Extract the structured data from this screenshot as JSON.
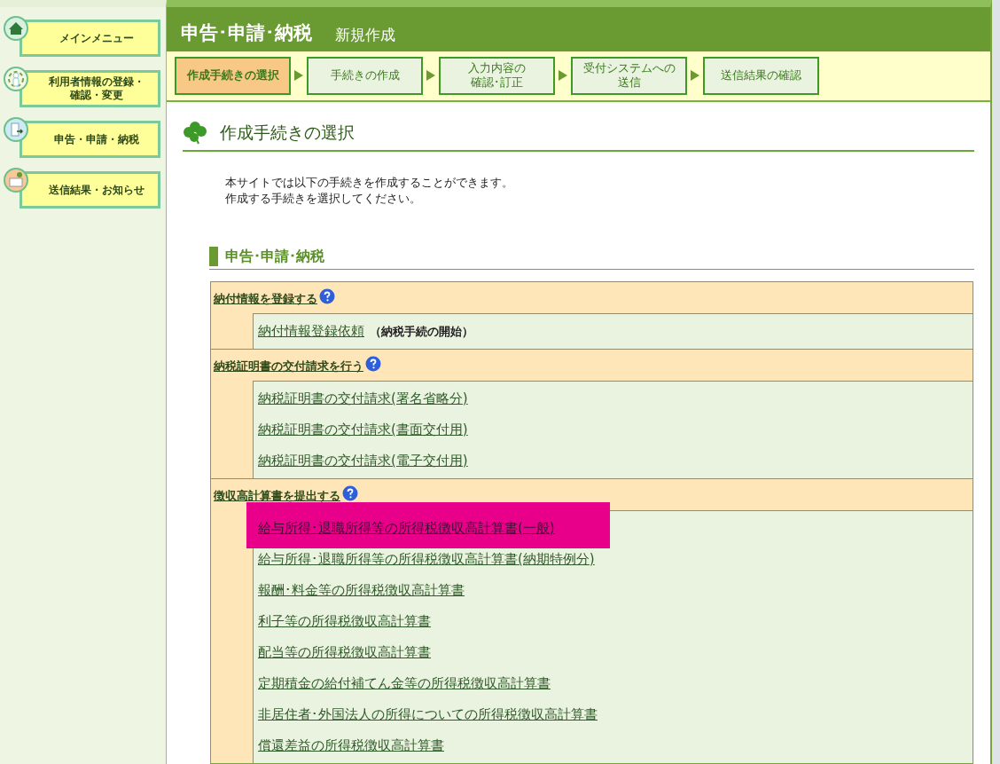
{
  "sidebar": {
    "items": [
      {
        "label": "メインメニュー",
        "kind": "house"
      },
      {
        "label": [
          "利用者情報の登録・",
          "確認・変更"
        ],
        "kind": "person"
      },
      {
        "label": "申告・申請・納税",
        "kind": "door"
      },
      {
        "label": "送信結果・お知らせ",
        "kind": "mail"
      }
    ]
  },
  "header": {
    "title": "申告･申請･納税",
    "subtitle": "新規作成"
  },
  "steps": [
    {
      "label": "作成手続きの選択",
      "selected": true
    },
    {
      "label": "手続きの作成",
      "selected": false
    },
    {
      "label": [
        "入力内容の",
        "確認･訂正"
      ],
      "selected": false
    },
    {
      "label": [
        "受付システムへの",
        "送信"
      ],
      "selected": false
    },
    {
      "label": "送信結果の確認",
      "selected": false
    }
  ],
  "page_title": "作成手続きの選択",
  "intro": [
    "本サイトでは以下の手続きを作成することができます。",
    "作成する手続きを選択してください。"
  ],
  "section_title": "申告･申請･納税",
  "groups": [
    {
      "title": "納付情報を登録する",
      "items": [
        {
          "label": "納付情報登録依頼",
          "note": "（納税手続の開始）",
          "highlighted": false
        }
      ]
    },
    {
      "title": "納税証明書の交付請求を行う",
      "items": [
        {
          "label": "納税証明書の交付請求(署名省略分)",
          "highlighted": false
        },
        {
          "label": "納税証明書の交付請求(書面交付用)",
          "highlighted": false
        },
        {
          "label": "納税証明書の交付請求(電子交付用)",
          "highlighted": false
        }
      ]
    },
    {
      "title": "徴収高計算書を提出する",
      "items": [
        {
          "label": "給与所得･退職所得等の所得税徴収高計算書(一般)",
          "highlighted": true
        },
        {
          "label": "給与所得･退職所得等の所得税徴収高計算書(納期特例分)",
          "highlighted": false
        },
        {
          "label": "報酬･料金等の所得税徴収高計算書",
          "highlighted": false
        },
        {
          "label": "利子等の所得税徴収高計算書",
          "highlighted": false
        },
        {
          "label": "配当等の所得税徴収高計算書",
          "highlighted": false
        },
        {
          "label": "定期積金の給付補てん金等の所得税徴収高計算書",
          "highlighted": false
        },
        {
          "label": "非居住者･外国法人の所得についての所得税徴収高計算書",
          "highlighted": false
        },
        {
          "label": "償還差益の所得税徴収高計算書",
          "highlighted": false
        }
      ]
    }
  ]
}
